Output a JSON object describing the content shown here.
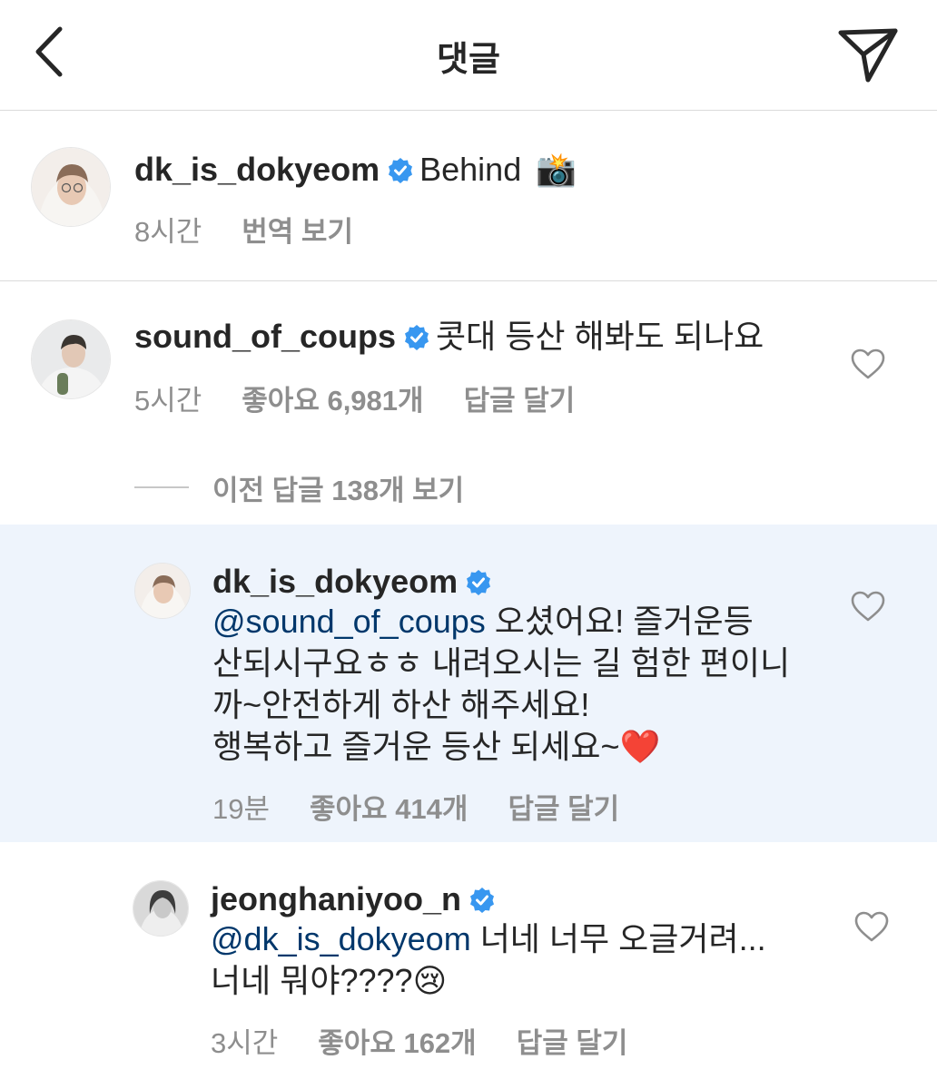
{
  "header": {
    "title": "댓글",
    "back_icon": "chevron-left-icon",
    "share_icon": "paper-plane-icon"
  },
  "caption": {
    "username": "dk_is_dokyeom",
    "verified": true,
    "text": "Behind",
    "emoji": "📸",
    "time": "8시간",
    "translate": "번역 보기"
  },
  "comment1": {
    "username": "sound_of_coups",
    "verified": true,
    "text": "콧대 등산 해봐도 되나요",
    "time": "5시간",
    "likes": "좋아요 6,981개",
    "reply": "답글 달기"
  },
  "view_previous": "이전 답글 138개 보기",
  "reply1": {
    "username": "dk_is_dokyeom",
    "verified": true,
    "mention": "@sound_of_coups",
    "line1": " 오셨어요! 즐거운등",
    "line2": "산되시구요ㅎㅎ 내려오시는 길 험한 편이니",
    "line3": "까~안전하게 하산 해주세요!",
    "line4": "행복하고 즐거운 등산 되세요~",
    "emoji": "❤️",
    "time": "19분",
    "likes": "좋아요 414개",
    "reply": "답글 달기"
  },
  "reply2": {
    "username": "jeonghaniyoo_n",
    "verified": true,
    "mention": "@dk_is_dokyeom",
    "line1": " 너네 너무 오글거려...",
    "line2": "너네 뭐야????",
    "emoji": "😢",
    "time": "3시간",
    "likes": "좋아요 162개",
    "reply": "답글 달기"
  },
  "colors": {
    "highlight_bg": "#eef4fc",
    "verified_blue": "#3897f0",
    "mention": "#00376b",
    "meta_gray": "#8e8e8e"
  }
}
